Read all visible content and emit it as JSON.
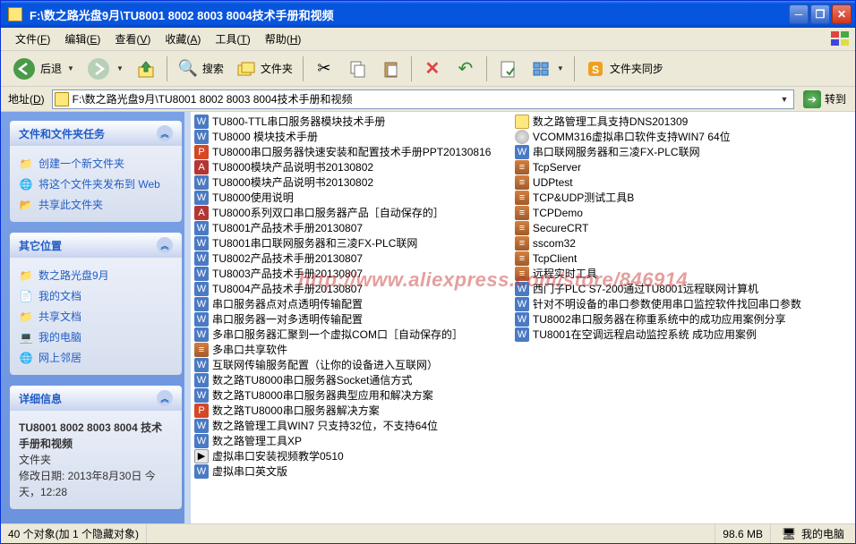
{
  "window": {
    "title": "F:\\数之路光盘9月\\TU8001 8002 8003 8004技术手册和视频"
  },
  "menu": [
    {
      "pre": "文件(",
      "hot": "F",
      "post": ")"
    },
    {
      "pre": "编辑(",
      "hot": "E",
      "post": ")"
    },
    {
      "pre": "查看(",
      "hot": "V",
      "post": ")"
    },
    {
      "pre": "收藏(",
      "hot": "A",
      "post": ")"
    },
    {
      "pre": "工具(",
      "hot": "T",
      "post": ")"
    },
    {
      "pre": "帮助(",
      "hot": "H",
      "post": ")"
    }
  ],
  "toolbar": {
    "back": "后退",
    "search": "搜索",
    "folders": "文件夹",
    "sync": "文件夹同步"
  },
  "address": {
    "label_pre": "地址(",
    "label_hot": "D",
    "label_post": ")",
    "path": "F:\\数之路光盘9月\\TU8001 8002 8003 8004技术手册和视频",
    "go": "转到"
  },
  "side": {
    "tasks": {
      "title": "文件和文件夹任务",
      "items": [
        {
          "text": "创建一个新文件夹"
        },
        {
          "text": "将这个文件夹发布到 Web"
        },
        {
          "text": "共享此文件夹"
        }
      ]
    },
    "other": {
      "title": "其它位置",
      "items": [
        {
          "text": "数之路光盘9月"
        },
        {
          "text": "我的文档"
        },
        {
          "text": "共享文档"
        },
        {
          "text": "我的电脑"
        },
        {
          "text": "网上邻居"
        }
      ]
    },
    "details": {
      "title": "详细信息",
      "name": "TU8001 8002 8003 8004 技术手册和视频",
      "type": "文件夹",
      "mod_label": "修改日期: 2013年8月30日 今天，12:28"
    }
  },
  "files_col1": [
    {
      "ic": "ic-word",
      "g": "W",
      "n": "TU800-TTL串口服务器模块技术手册"
    },
    {
      "ic": "ic-word",
      "g": "W",
      "n": "TU8000 模块技术手册"
    },
    {
      "ic": "ic-ppt",
      "g": "P",
      "n": "TU8000串口服务器快速安装和配置技术手册PPT20130816"
    },
    {
      "ic": "ic-pdf",
      "g": "A",
      "n": "TU8000模块产品说明书20130802"
    },
    {
      "ic": "ic-word",
      "g": "W",
      "n": "TU8000模块产品说明书20130802"
    },
    {
      "ic": "ic-word",
      "g": "W",
      "n": "TU8000使用说明"
    },
    {
      "ic": "ic-pdf",
      "g": "A",
      "n": "TU8000系列双口串口服务器产品［自动保存的］"
    },
    {
      "ic": "ic-word",
      "g": "W",
      "n": "TU8001产品技术手册20130807"
    },
    {
      "ic": "ic-word",
      "g": "W",
      "n": "TU8001串口联网服务器和三凌FX-PLC联网"
    },
    {
      "ic": "ic-word",
      "g": "W",
      "n": "TU8002产品技术手册20130807"
    },
    {
      "ic": "ic-word",
      "g": "W",
      "n": "TU8003产品技术手册20130807"
    },
    {
      "ic": "ic-word",
      "g": "W",
      "n": "TU8004产品技术手册20130807"
    },
    {
      "ic": "ic-word",
      "g": "W",
      "n": "串口服务器点对点透明传输配置"
    },
    {
      "ic": "ic-word",
      "g": "W",
      "n": "串口服务器一对多透明传输配置"
    },
    {
      "ic": "ic-word",
      "g": "W",
      "n": "多串口服务器汇聚到一个虚拟COM口［自动保存的］"
    },
    {
      "ic": "ic-zip",
      "g": "≡",
      "n": "多串口共享软件"
    },
    {
      "ic": "ic-word",
      "g": "W",
      "n": "互联网传输服务配置（让你的设备进入互联网）"
    },
    {
      "ic": "ic-word",
      "g": "W",
      "n": "数之路TU8000串口服务器Socket通信方式"
    },
    {
      "ic": "ic-word",
      "g": "W",
      "n": "数之路TU8000串口服务器典型应用和解决方案"
    },
    {
      "ic": "ic-ppt",
      "g": "P",
      "n": "数之路TU8000串口服务器解决方案"
    },
    {
      "ic": "ic-word",
      "g": "W",
      "n": "数之路管理工具WIN7 只支持32位，不支持64位"
    },
    {
      "ic": "ic-word",
      "g": "W",
      "n": "数之路管理工具XP"
    },
    {
      "ic": "ic-app",
      "g": "▶",
      "n": "虚拟串口安装视频教学0510"
    },
    {
      "ic": "ic-word",
      "g": "W",
      "n": "虚拟串口英文版"
    }
  ],
  "files_col2": [
    {
      "ic": "ic-folder",
      "g": "",
      "n": "数之路管理工具支持DNS201309"
    },
    {
      "ic": "ic-cd",
      "g": "",
      "n": "VCOMM316虚拟串口软件支持WIN7 64位"
    },
    {
      "ic": "ic-word",
      "g": "W",
      "n": "串口联网服务器和三凌FX-PLC联网"
    },
    {
      "ic": "ic-zip",
      "g": "≡",
      "n": "TcpServer"
    },
    {
      "ic": "ic-zip",
      "g": "≡",
      "n": "UDPtest"
    },
    {
      "ic": "ic-zip",
      "g": "≡",
      "n": "TCP&UDP测试工具B"
    },
    {
      "ic": "ic-zip",
      "g": "≡",
      "n": "TCPDemo"
    },
    {
      "ic": "ic-zip",
      "g": "≡",
      "n": "SecureCRT"
    },
    {
      "ic": "ic-zip",
      "g": "≡",
      "n": "sscom32"
    },
    {
      "ic": "ic-zip",
      "g": "≡",
      "n": "TcpClient"
    },
    {
      "ic": "ic-zip",
      "g": "≡",
      "n": "远程实时工具"
    },
    {
      "ic": "ic-word",
      "g": "W",
      "n": "西门子PLC S7-200通过TU8001远程联网计算机"
    },
    {
      "ic": "ic-word",
      "g": "W",
      "n": "针对不明设备的串口参数使用串口监控软件找回串口参数"
    },
    {
      "ic": "ic-word",
      "g": "W",
      "n": "TU8002串口服务器在称重系统中的成功应用案例分享"
    },
    {
      "ic": "ic-word",
      "g": "W",
      "n": "TU8001在空调远程启动监控系统 成功应用案例"
    }
  ],
  "status": {
    "count": "40 个对象(加 1 个隐藏对象)",
    "size": "98.6 MB",
    "loc": "我的电脑"
  },
  "watermark": "http://www.aliexpress.com/store/846914"
}
